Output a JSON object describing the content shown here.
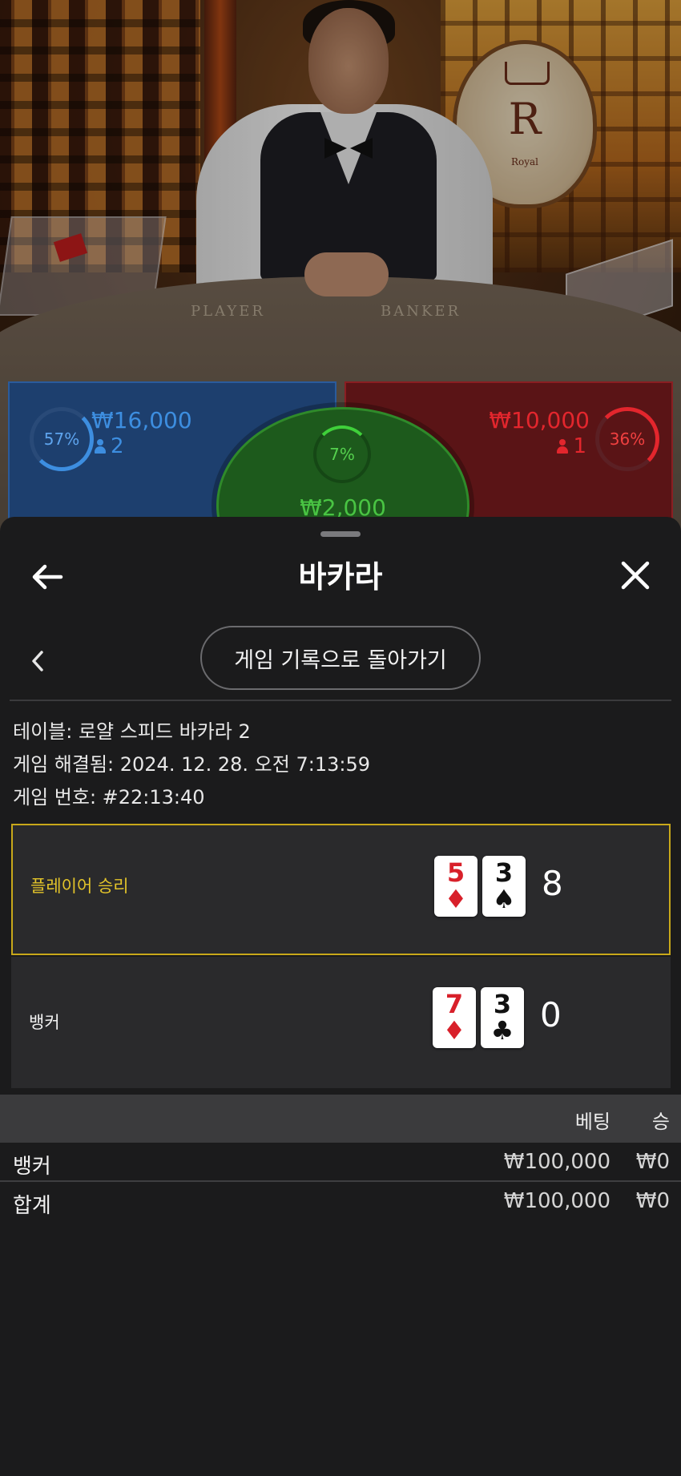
{
  "live_table": {
    "table_labels": {
      "player": "PLAYER",
      "banker": "BANKER"
    },
    "emblem_letter": "R",
    "emblem_text": "Royal",
    "player_bet": {
      "percent": "57%",
      "amount": "₩16,000",
      "count": "2",
      "color": "#3d8ee0"
    },
    "banker_bet": {
      "percent": "36%",
      "amount": "₩10,000",
      "count": "1",
      "color": "#e3262d"
    },
    "tie_bet": {
      "percent": "7%",
      "amount": "₩2,000",
      "color": "#3fd03a"
    }
  },
  "sheet": {
    "title": "바카라",
    "back_icon": "arrow-left-icon",
    "close_icon": "close-x-icon",
    "history_button": "게임 기록으로 돌아가기",
    "table_info": "테이블: 로얄 스피드 바카라 2",
    "resolved_info": "게임 해결됨: 2024. 12. 28. 오전 7:13:59",
    "game_number": "게임 번호: #22:13:40"
  },
  "hands": {
    "player": {
      "label": "플레이어 승리",
      "cards": [
        {
          "rank": "5",
          "suit": "♦"
        },
        {
          "rank": "3",
          "suit": "♠"
        }
      ],
      "score": "8",
      "highlight_color": "#c8a81a"
    },
    "banker": {
      "label": "뱅커",
      "cards": [
        {
          "rank": "7",
          "suit": "♦"
        },
        {
          "rank": "3",
          "suit": "♣"
        }
      ],
      "score": "0"
    }
  },
  "bets_table": {
    "headers": {
      "bet": "베팅",
      "win": "승"
    },
    "rows": [
      {
        "name": "뱅커",
        "bet": "₩100,000",
        "win": "₩0"
      },
      {
        "name": "합계",
        "bet": "₩100,000",
        "win": "₩0"
      }
    ]
  }
}
